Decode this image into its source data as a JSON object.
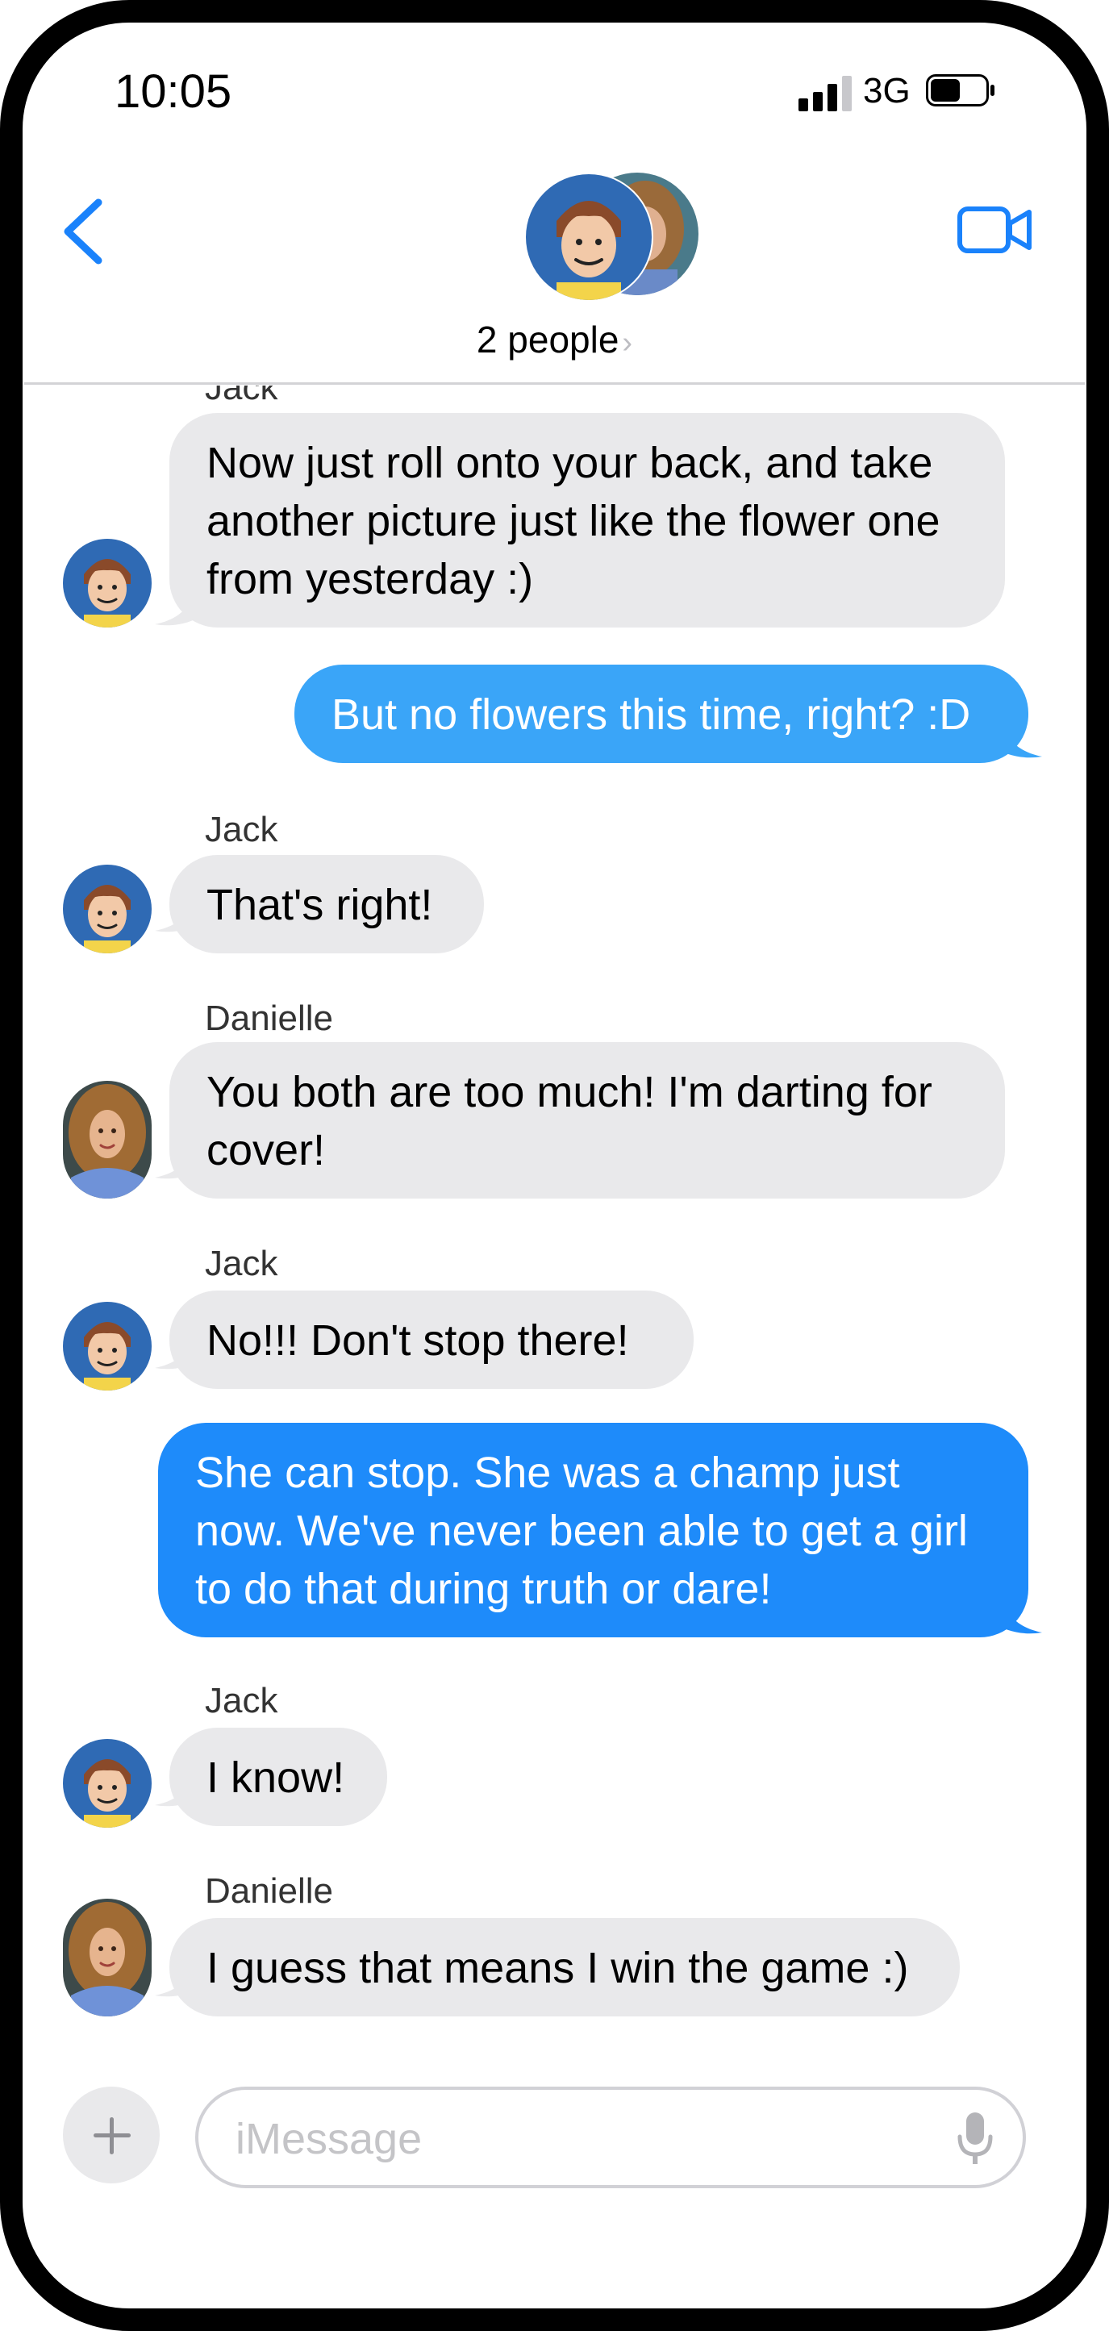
{
  "status_bar": {
    "time": "10:05",
    "network": "3G",
    "signal_bars": 3,
    "battery_level": 0.55
  },
  "header": {
    "people_label": "2 people",
    "chevron": "›",
    "back_icon": "chevron-left",
    "video_icon": "video-camera"
  },
  "colors": {
    "accent": "#1a82fb",
    "incoming_bubble": "#e9e9eb",
    "outgoing_bubble_light": "#3aa5f8",
    "outgoing_bubble": "#1e8bfa",
    "avatar_bg": "#2f6ab4"
  },
  "messages": [
    {
      "sender": "Jack",
      "text": "Now just roll onto your back, and take another picture just like the flower one from yesterday :)"
    },
    {
      "text": "But no flowers this time, right? :D"
    },
    {
      "sender": "Jack",
      "text": "That's right!"
    },
    {
      "sender": "Danielle",
      "text": "You both are too much!  I'm darting for cover!"
    },
    {
      "sender": "Jack",
      "text": "No!!!  Don't stop there!"
    },
    {
      "text": "She can stop.  She was a champ just now.  We've never been able to get a girl to do that during truth or dare!"
    },
    {
      "sender": "Jack",
      "text": "I know!"
    },
    {
      "sender": "Danielle",
      "text": "I guess that means I win the game :)"
    }
  ],
  "compose": {
    "placeholder": "iMessage",
    "value": "",
    "plus_icon": "plus",
    "mic_icon": "microphone"
  }
}
